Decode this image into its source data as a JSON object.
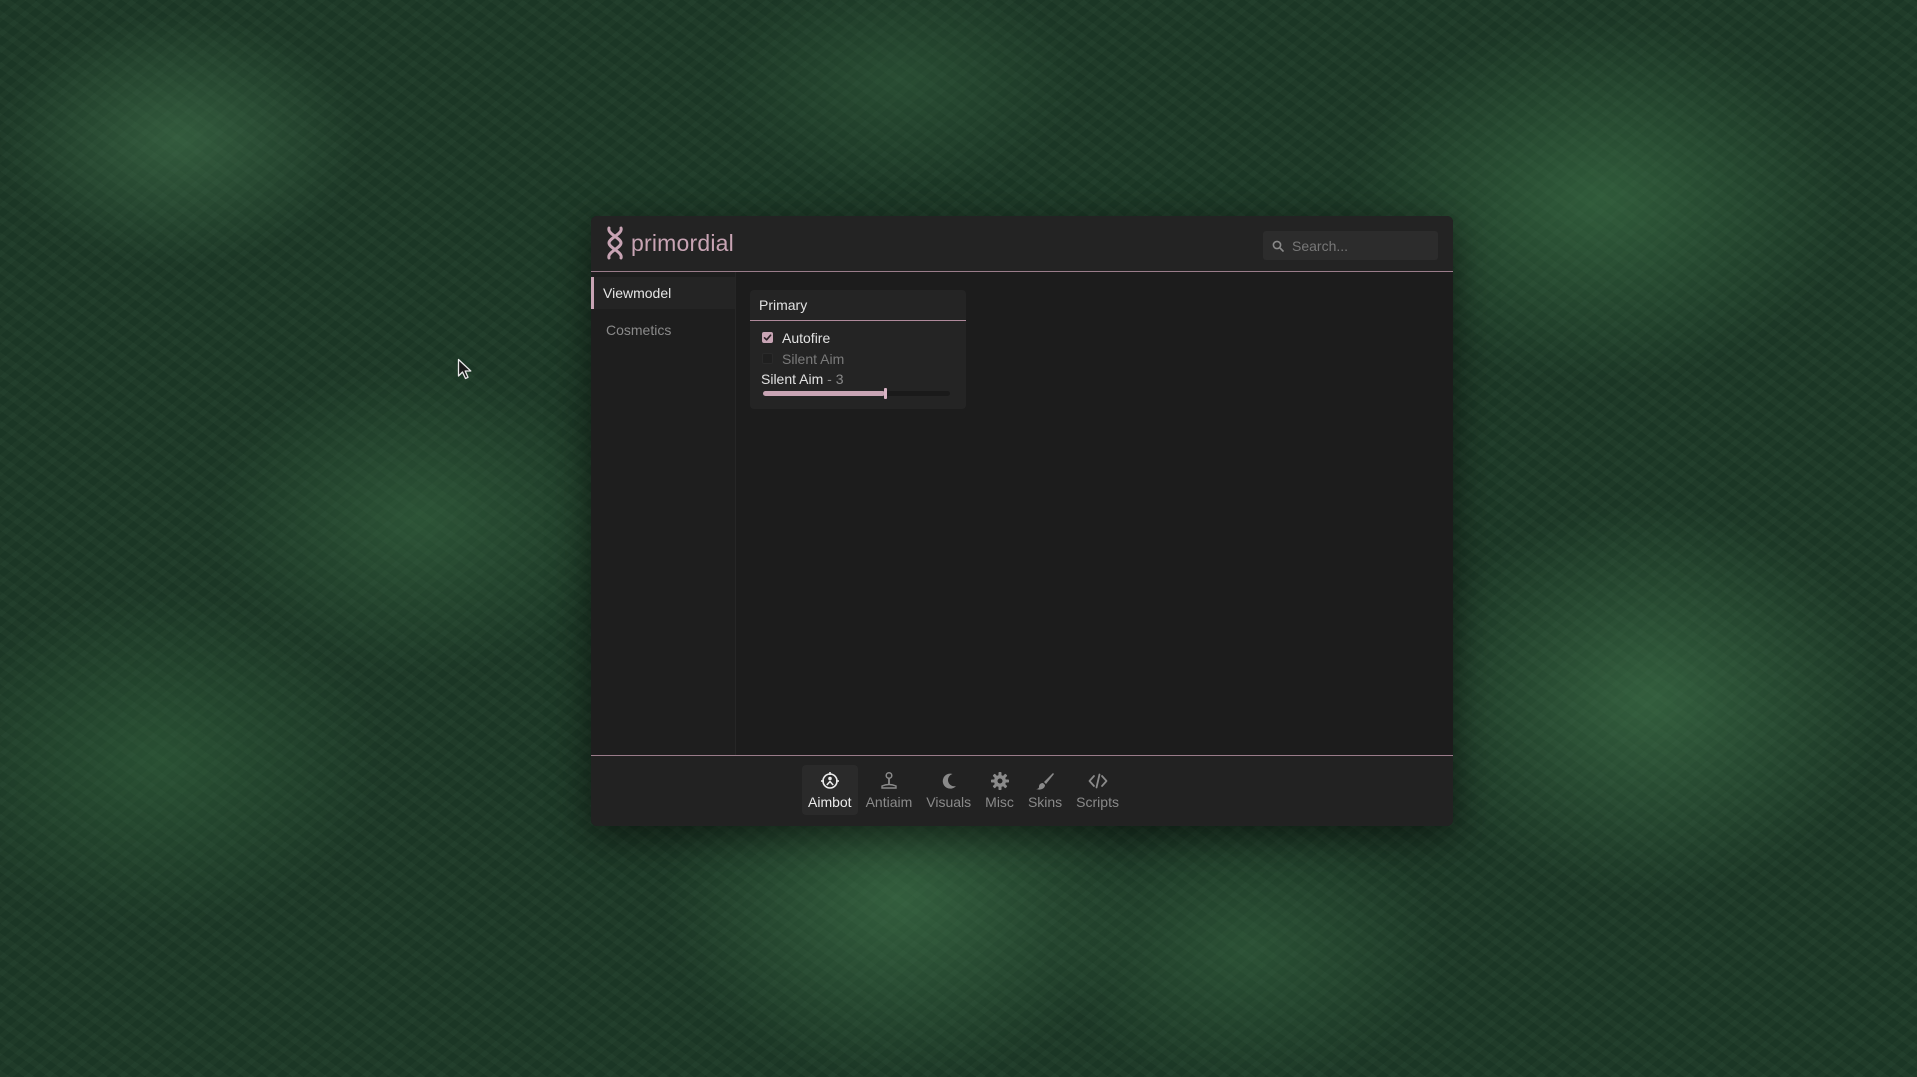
{
  "app": {
    "brand": "primordial",
    "accent_color": "#c8a4b4"
  },
  "search": {
    "placeholder": "Search...",
    "value": ""
  },
  "sidebar": {
    "items": [
      {
        "label": "Viewmodel",
        "active": true
      },
      {
        "label": "Cosmetics",
        "active": false
      }
    ]
  },
  "group": {
    "title": "Primary",
    "options": [
      {
        "label": "Autofire",
        "checked": true
      },
      {
        "label": "Silent Aim",
        "checked": false
      }
    ],
    "slider": {
      "label": "Silent Aim",
      "value_text": "- 3",
      "fraction": 0.65
    }
  },
  "tabs": [
    {
      "label": "Aimbot",
      "icon": "crosshair-icon",
      "active": true
    },
    {
      "label": "Antiaim",
      "icon": "joystick-icon",
      "active": false
    },
    {
      "label": "Visuals",
      "icon": "moon-icon",
      "active": false
    },
    {
      "label": "Misc",
      "icon": "gear-icon",
      "active": false
    },
    {
      "label": "Skins",
      "icon": "brush-icon",
      "active": false
    },
    {
      "label": "Scripts",
      "icon": "code-icon",
      "active": false
    }
  ]
}
